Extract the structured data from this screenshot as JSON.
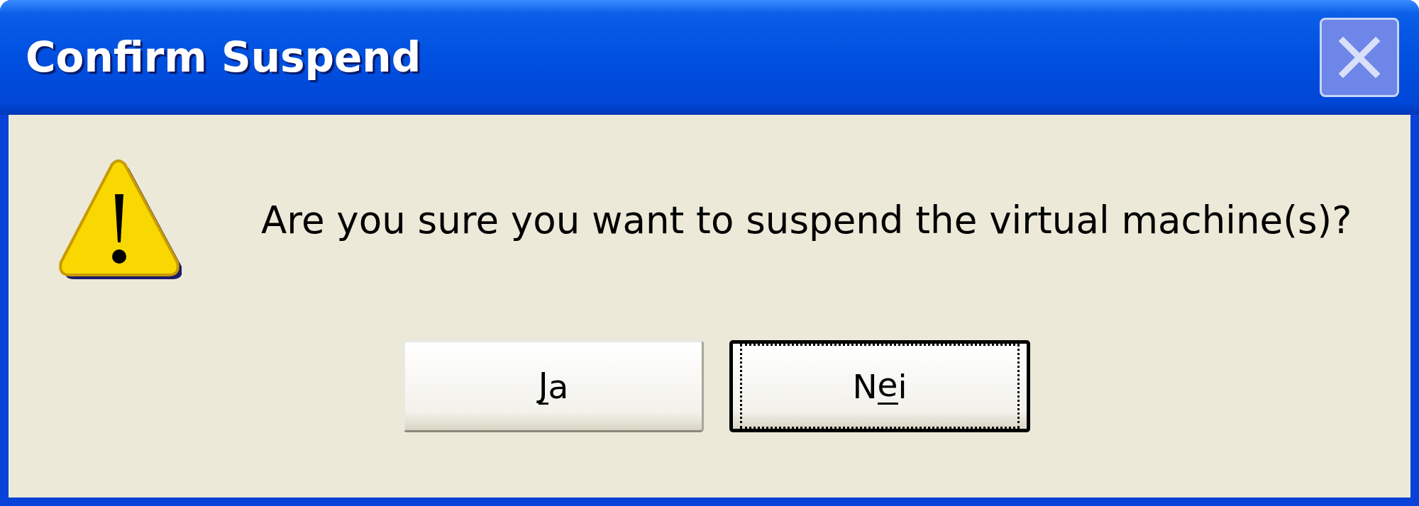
{
  "window": {
    "title": "Confirm Suspend"
  },
  "message": "Are you sure you want to suspend the virtual machine(s)?",
  "buttons": [
    {
      "label": {
        "key": "J",
        "post": "a"
      },
      "default": false
    },
    {
      "label": {
        "pre": "N",
        "key": "e",
        "post": "i"
      },
      "default": true
    }
  ]
}
